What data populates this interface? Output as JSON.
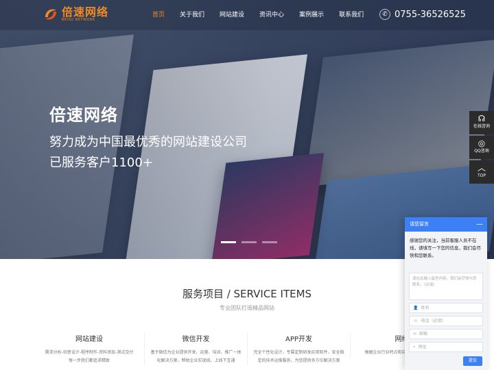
{
  "header": {
    "logo_name": "倍速网络",
    "logo_sub": "BEISU NETWORK",
    "nav": [
      "首页",
      "关于我们",
      "网站建设",
      "资讯中心",
      "案例展示",
      "联系我们"
    ],
    "active_nav": "首页",
    "phone": "0755-36526525",
    "phone_icon": "phone-icon",
    "colors": {
      "accent": "#f08a24"
    }
  },
  "hero": {
    "title": "倍速网络",
    "line1": "努力成为中国最优秀的网站建设公司",
    "line2": "已服务客户1100+"
  },
  "float_bar": [
    {
      "icon": "headset-icon",
      "label": "在线咨询"
    },
    {
      "icon": "qq-icon",
      "label": "QQ咨询"
    },
    {
      "icon": "chevron-up-icon",
      "label": "TOP"
    }
  ],
  "services": {
    "title": "服务项目 / SERVICE ITEMS",
    "subtitle": "专业团队打造精品网站",
    "items": [
      {
        "name": "网站建设",
        "desc": "需求分析-创意设计-程序制作-资料添加-测试交付每一步我们都追求精致"
      },
      {
        "name": "微信开发",
        "desc": "基于微信为企业提供开发、运营、培训、推广一体化解决方案，帮助企业实现线、上线下互通"
      },
      {
        "name": "APP开发",
        "desc": "完全个性化设计，专属定制研发应用软件，安全稳定的技术运维服务，为您提供多方位解决方案"
      },
      {
        "name": "网络",
        "desc": "根据企业行业特点和自身提供长期的网络"
      }
    ]
  },
  "chat": {
    "title": "请您留言",
    "message": "感谢您的关注，当前客服人员不在线，请填写一下您的信息，我们会尽快和您联系。",
    "textarea_placeholder": "请在此输入留言内容，我们会尽快与您联系。（必填）",
    "fields": [
      "姓名",
      "电话（必填）",
      "邮箱",
      "地址"
    ],
    "submit": "提交",
    "colors": {
      "primary": "#3d7ff5"
    }
  }
}
